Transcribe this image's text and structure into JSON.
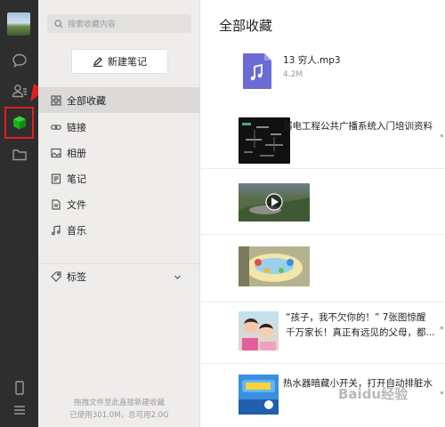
{
  "search": {
    "placeholder": "搜索收藏内容"
  },
  "new_note_label": "新建笔记",
  "nav": {
    "items": [
      {
        "label": "全部收藏",
        "icon": "grid-icon"
      },
      {
        "label": "链接",
        "icon": "link-icon"
      },
      {
        "label": "相册",
        "icon": "image-icon"
      },
      {
        "label": "笔记",
        "icon": "note-icon"
      },
      {
        "label": "文件",
        "icon": "file-icon"
      },
      {
        "label": "音乐",
        "icon": "music-icon"
      }
    ],
    "tags_label": "标签"
  },
  "footer": {
    "hint": "拖拽文件至此直接新建收藏",
    "usage": "已使用301.0M，总可用2.0G"
  },
  "content": {
    "title": "全部收藏",
    "items": [
      {
        "type": "music",
        "title": "13  穷人.mp3",
        "size": "4.2M"
      },
      {
        "type": "link",
        "title": "弱电工程公共广播系统入门培训资料"
      },
      {
        "type": "video"
      },
      {
        "type": "image"
      },
      {
        "type": "link",
        "line1": "“孩子，我不欠你的！” 7张图惊醒",
        "line2": "千万家长！真正有远见的父母，都..."
      },
      {
        "type": "link",
        "title": "热水器暗藏小开关，打开自动排脏水"
      }
    ]
  },
  "colors": {
    "rail": "#2e2e2e",
    "accent_green": "#1aad19",
    "highlight_red": "#e02020",
    "music_purple": "#6b6bd6"
  },
  "watermark": "Baidu经验"
}
